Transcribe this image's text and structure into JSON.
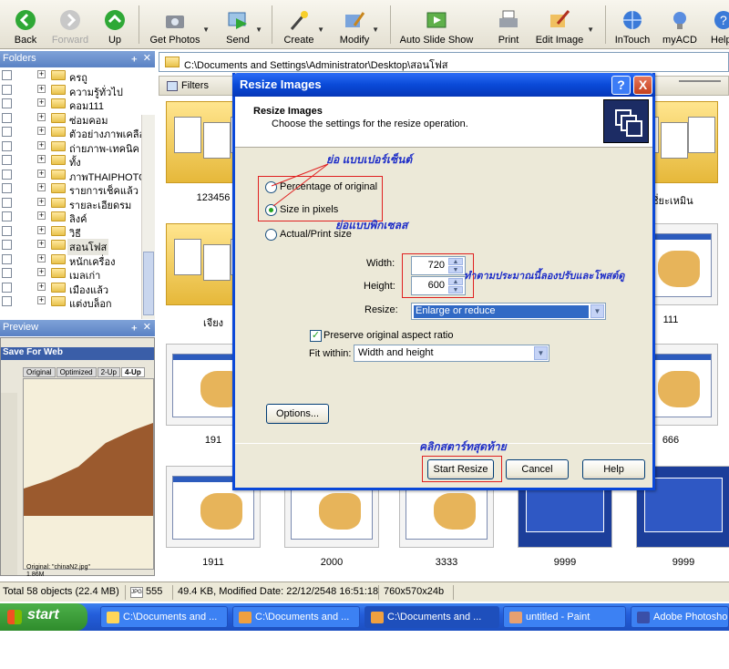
{
  "toolbar": {
    "buttons": [
      {
        "label": "Back",
        "icon": "back-arrow-icon"
      },
      {
        "label": "Forward",
        "icon": "forward-arrow-icon"
      },
      {
        "label": "Up",
        "icon": "up-arrow-icon"
      },
      {
        "label": "Get Photos",
        "icon": "camera-icon"
      },
      {
        "label": "Send",
        "icon": "send-icon"
      },
      {
        "label": "Create",
        "icon": "wand-icon"
      },
      {
        "label": "Modify",
        "icon": "paint-brush-icon"
      },
      {
        "label": "Auto Slide Show",
        "icon": "slideshow-icon"
      },
      {
        "label": "Print",
        "icon": "printer-icon"
      },
      {
        "label": "Edit Image",
        "icon": "edit-image-icon"
      },
      {
        "label": "InTouch",
        "icon": "globe-icon"
      },
      {
        "label": "myACD",
        "icon": "lightbulb-icon"
      },
      {
        "label": "Help",
        "icon": "help-icon"
      }
    ]
  },
  "folders": {
    "title": "Folders",
    "items": [
      "ครถู",
      "ความรู้ทั่วไป",
      "คอม111",
      "ซ่อมคอม",
      "ตัวอย่างภาพเคลือ",
      "ถ่ายภาพ-เทคนิค",
      "ทั้ง",
      "ภาพTHAIPHOTO",
      "รายการเช็คแล้ว",
      "รายละเอียดรม",
      "ลิงค์",
      "วิธี",
      "สอนโฟส",
      "หนักเครื่อง",
      "เมลเก่า",
      "เมืองแล้ว",
      "แต่งบล็อก"
    ],
    "selected_index": 12
  },
  "preview": {
    "title": "Preview",
    "save_for_web": "Save For Web",
    "tabs": [
      "Original",
      "Optimized",
      "2-Up",
      "4-Up"
    ],
    "caption_line1": "Original: \"chinaN2.jpg\"",
    "caption_line2": "1.86M"
  },
  "address": {
    "path": "C:\\Documents and Settings\\Administrator\\Desktop\\สอนโฟส"
  },
  "filterbar": {
    "label": "Filters"
  },
  "thumbnails": [
    {
      "label": "123456",
      "kind": "folder"
    },
    {
      "label": "เชี่ยะเหมิน",
      "kind": "folder"
    },
    {
      "label": "เจียง",
      "kind": "folder"
    },
    {
      "label": "111",
      "kind": "screen"
    },
    {
      "label": "191",
      "kind": "screen"
    },
    {
      "label": "666",
      "kind": "screen"
    },
    {
      "label": "1911",
      "kind": "screen"
    },
    {
      "label": "2000",
      "kind": "screen"
    },
    {
      "label": "3333",
      "kind": "screen"
    },
    {
      "label": "9999",
      "kind": "blue"
    },
    {
      "label": "9999",
      "kind": "blue"
    }
  ],
  "status": {
    "total": "Total 58 objects  (22.4 MB)",
    "count": "555",
    "info": "49.4 KB, Modified Date: 22/12/2548 16:51:18",
    "dims": "760x570x24b"
  },
  "taskbar": {
    "start_label": "start",
    "tasks": [
      {
        "label": "C:\\Documents and ..."
      },
      {
        "label": "C:\\Documents and ..."
      },
      {
        "label": "C:\\Documents and ..."
      },
      {
        "label": "untitled - Paint"
      },
      {
        "label": "Adobe Photoshop"
      }
    ]
  },
  "dialog": {
    "title": "Resize Images",
    "help_glyph": "?",
    "close_glyph": "X",
    "header_title": "Resize Images",
    "header_subtitle": "Choose the settings for the resize operation.",
    "options": [
      "Percentage of original",
      "Size in pixels",
      "Actual/Print size"
    ],
    "selected_option_index": 1,
    "width_label": "Width:",
    "width_value": "720",
    "height_label": "Height:",
    "height_value": "600",
    "resize_label": "Resize:",
    "resize_value": "Enlarge or reduce",
    "preserve_label": "Preserve original aspect ratio",
    "preserve_checked": true,
    "fit_label": "Fit within:",
    "fit_value": "Width and height",
    "options_button": "Options...",
    "start_button": "Start Resize",
    "cancel_button": "Cancel",
    "help_button": "Help"
  },
  "annotations": {
    "note_percent": "ย่อ แบบเปอร์เซ็นต์",
    "note_pixels": "ย่อแบบพิกเซลส",
    "note_size": "ทำตามประมาณนี้ลองปรับและโพสต์ดู",
    "note_start": "คลิกสตาร์ทสุดท้าย"
  },
  "colors": {
    "title_bar": "#0a4ad8",
    "annotation_red": "#e02020",
    "annotation_blue": "#1e2ec8",
    "selection": "#316ac5"
  }
}
